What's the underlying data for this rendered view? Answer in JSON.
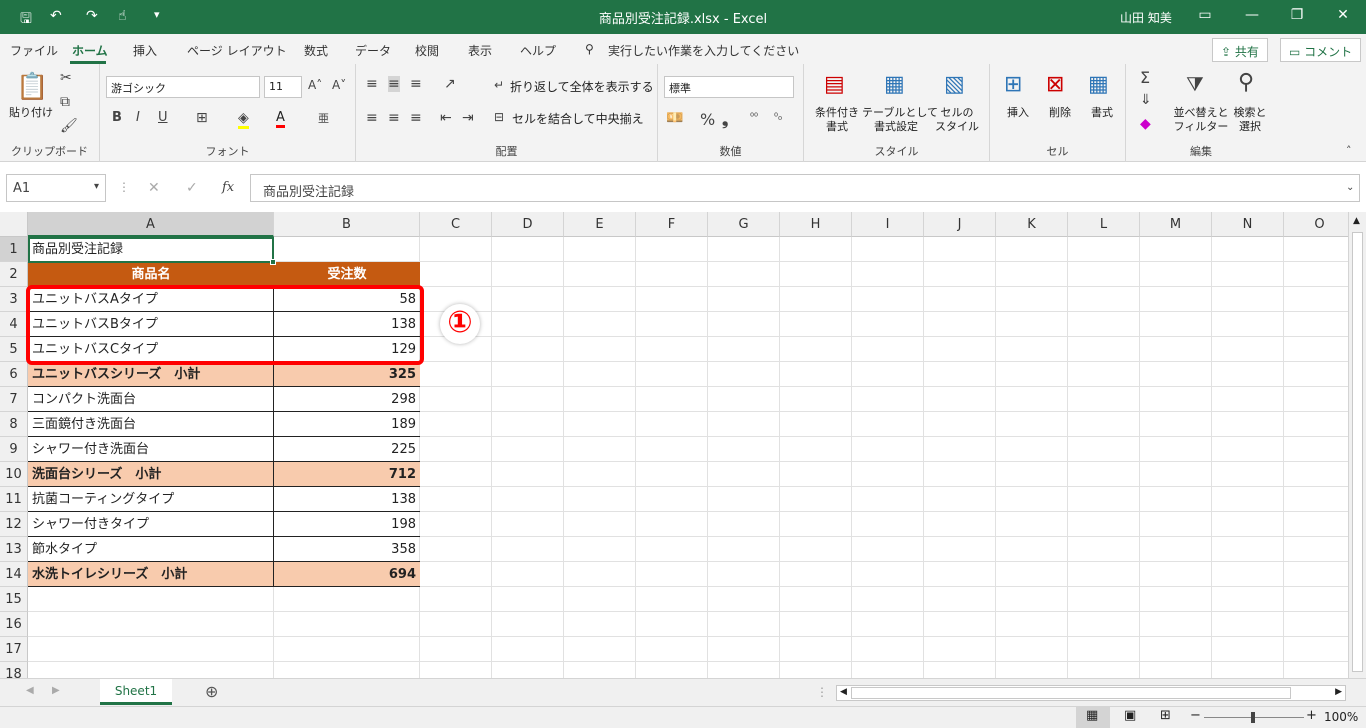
{
  "titlebar": {
    "title": "商品別受注記録.xlsx  -  Excel",
    "user": "山田 知美",
    "save_icon": "save-icon",
    "undo_icon": "undo-icon",
    "redo_icon": "redo-icon",
    "touch_icon": "touch-mode-icon",
    "customize_icon": "customize-qat-icon",
    "ribbon_display_icon": "ribbon-display-options-icon",
    "minimize_icon": "minimize-icon",
    "maximize_icon": "restore-icon",
    "close_icon": "close-icon"
  },
  "menu": {
    "tabs": [
      "ファイル",
      "ホーム",
      "挿入",
      "ページ レイアウト",
      "数式",
      "データ",
      "校閲",
      "表示",
      "ヘルプ"
    ],
    "active": "ホーム",
    "tell_me": "実行したい作業を入力してください",
    "share": "共有",
    "comment": "コメント"
  },
  "ribbon": {
    "clipboard": {
      "paste": "貼り付け",
      "label": "クリップボード"
    },
    "font": {
      "name": "游ゴシック",
      "size": "11",
      "bold": "B",
      "italic": "I",
      "underline": "U",
      "label": "フォント"
    },
    "alignment": {
      "wrap": "折り返して全体を表示する",
      "merge": "セルを結合して中央揃え",
      "label": "配置"
    },
    "number": {
      "format": "標準",
      "percent": "%",
      "comma": "❟",
      "label": "数値"
    },
    "styles": {
      "conditional": "条件付き\n書式",
      "table": "テーブルとして\n書式設定",
      "cell_styles": "セルの\nスタイル",
      "label": "スタイル"
    },
    "cells": {
      "insert": "挿入",
      "delete": "削除",
      "format": "書式",
      "label": "セル"
    },
    "editing": {
      "sort": "並べ替えと\nフィルター",
      "find": "検索と\n選択",
      "sigma": "Σ",
      "label": "編集"
    }
  },
  "formula_bar": {
    "name_box": "A1",
    "fx": "fx",
    "content": "商品別受注記録"
  },
  "columns": [
    "A",
    "B",
    "C",
    "D",
    "E",
    "F",
    "G",
    "H",
    "I",
    "J",
    "K",
    "L",
    "M",
    "N",
    "O"
  ],
  "rows": [
    "1",
    "2",
    "3",
    "4",
    "5",
    "6",
    "7",
    "8",
    "9",
    "10",
    "11",
    "12",
    "13",
    "14",
    "15",
    "16",
    "17",
    "18"
  ],
  "sheet": {
    "title": "商品別受注記録",
    "header": {
      "name": "商品名",
      "qty": "受注数"
    },
    "data": [
      {
        "name": "ユニットバスAタイプ",
        "qty": "58",
        "type": "item"
      },
      {
        "name": "ユニットバスBタイプ",
        "qty": "138",
        "type": "item"
      },
      {
        "name": "ユニットバスCタイプ",
        "qty": "129",
        "type": "item"
      },
      {
        "name": "ユニットバスシリーズ　小計",
        "qty": "325",
        "type": "subtotal"
      },
      {
        "name": "コンパクト洗面台",
        "qty": "298",
        "type": "item"
      },
      {
        "name": "三面鏡付き洗面台",
        "qty": "189",
        "type": "item"
      },
      {
        "name": "シャワー付き洗面台",
        "qty": "225",
        "type": "item"
      },
      {
        "name": "洗面台シリーズ　小計",
        "qty": "712",
        "type": "subtotal"
      },
      {
        "name": "抗菌コーティングタイプ",
        "qty": "138",
        "type": "item"
      },
      {
        "name": "シャワー付きタイプ",
        "qty": "198",
        "type": "item"
      },
      {
        "name": "節水タイプ",
        "qty": "358",
        "type": "item"
      },
      {
        "name": "水洗トイレシリーズ　小計",
        "qty": "694",
        "type": "subtotal"
      }
    ]
  },
  "annotation": {
    "marker": "①"
  },
  "sheet_tabs": {
    "active": "Sheet1",
    "add": "⊕"
  },
  "status": {
    "zoom": "100%"
  },
  "colors": {
    "excel_green": "#217346",
    "header_fill": "#c55a11",
    "subtotal_fill": "#f8cbad",
    "highlight_red": "#ff0000"
  }
}
